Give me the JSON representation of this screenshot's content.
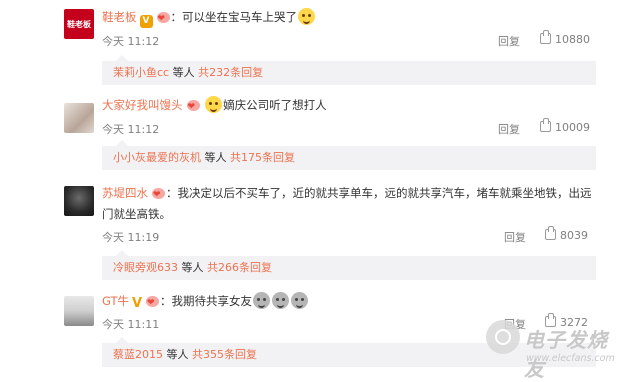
{
  "comments": [
    {
      "avatar_text": "鞋老板",
      "username": "鞋老板",
      "text": "：可以坐在宝马车上哭了",
      "time": "今天 11:12",
      "reply_label": "回复",
      "likes": "10880",
      "sub": {
        "names": "茉莉小鱼cc",
        "middle": " 等人 ",
        "count": "共232条回复"
      }
    },
    {
      "username": "大家好我叫馒头",
      "text": "嫡庆公司听了想打人",
      "time": "今天 11:12",
      "reply_label": "回复",
      "likes": "10009",
      "sub": {
        "names": "小小灰最爱的灰机",
        "middle": " 等人 ",
        "count": "共175条回复"
      }
    },
    {
      "username": "苏堤四水",
      "text_line1": "：我决定以后不买车了，近的就共享单车，远的就共享汽车，堵车就乘坐地铁，出远",
      "text_line2": "门就坐高铁。",
      "time": "今天 11:19",
      "reply_label": "回复",
      "likes": "8039",
      "sub": {
        "names": "冷眼旁观633",
        "middle": " 等人 ",
        "count": "共266条回复"
      }
    },
    {
      "username": "GT牛",
      "text": "：我期待共享女友",
      "time": "今天 11:11",
      "reply_label": "回复",
      "likes": "3272",
      "sub": {
        "names": "蔡蓝2015",
        "middle": " 等人 ",
        "count": "共355条回复"
      }
    }
  ],
  "watermark": {
    "cn": "电子发烧友",
    "url": "www.elecfans.com"
  },
  "colors": {
    "username": "#eb7350",
    "meta": "#808080",
    "sub_bg": "#f2f2f5"
  }
}
